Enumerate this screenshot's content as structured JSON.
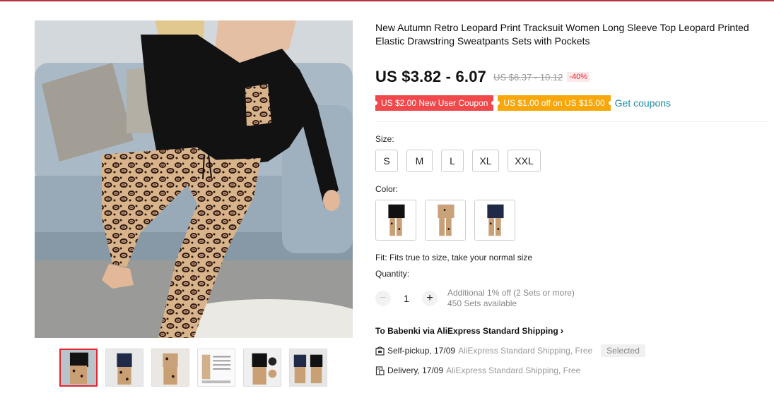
{
  "product": {
    "title": "New Autumn Retro Leopard Print Tracksuit Women Long Sleeve Top Leopard Printed Elastic Drawstring Sweatpants Sets with Pockets",
    "price": "US $3.82 - 6.07",
    "original_price": "US $6.37 - 10.12",
    "discount": "-40%"
  },
  "coupons": {
    "new_user": "US $2.00 New User Coupon",
    "store": "US $1.00 off on US $15.00",
    "get_link": "Get coupons"
  },
  "size": {
    "label": "Size:",
    "options": [
      "S",
      "M",
      "L",
      "XL",
      "XXL"
    ]
  },
  "color": {
    "label": "Color:",
    "options": [
      "black-top-leopard-pants",
      "khaki-leopard-set",
      "navy-top-leopard-pants"
    ]
  },
  "fit_text": "Fit: Fits true to size, take your normal size",
  "quantity": {
    "label": "Quantity:",
    "value": "1",
    "discount_note": "Additional 1% off (2 Sets or more)",
    "available": "450 Sets available"
  },
  "shipping": {
    "to_line": "To Babenki via AliExpress Standard Shipping",
    "pickup_main": "Self-pickup, 17/09",
    "pickup_sub": "AliExpress Standard Shipping, Free",
    "selected": "Selected",
    "delivery_main": "Delivery, 17/09",
    "delivery_sub": "AliExpress Standard Shipping, Free"
  },
  "colors": {
    "accent_red": "#e3262f",
    "coupon_red": "#f0484b",
    "coupon_orange": "#f7a70a",
    "link": "#1a8ba6"
  },
  "thumbnail_count": 6
}
